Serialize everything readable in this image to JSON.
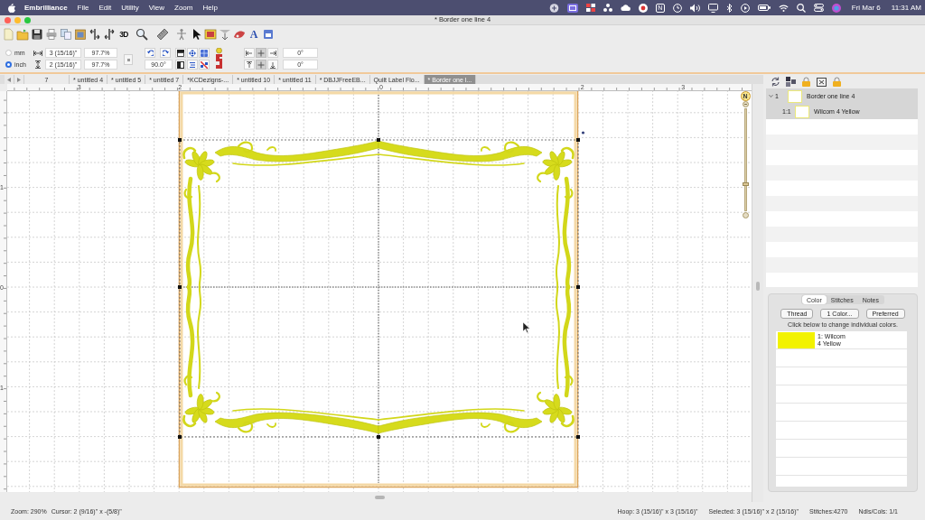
{
  "menu_bar": {
    "app_name": "Embrilliance",
    "menus": [
      "File",
      "Edit",
      "Utility",
      "View",
      "Zoom",
      "Help"
    ],
    "tray_letter": "N",
    "date": "Fri Mar 6",
    "time": "11:31 AM"
  },
  "window": {
    "title": "* Border one line 4"
  },
  "toolbar": {
    "text_tools": [
      "3D",
      "A"
    ]
  },
  "size": {
    "units": [
      {
        "label": "mm",
        "selected": false
      },
      {
        "label": "inch",
        "selected": true
      }
    ],
    "width": "3 (15/16)\"",
    "width_scale": "97.7%",
    "height": "2 (15/16)\"",
    "height_scale": "97.7%"
  },
  "arrange": {
    "rotation": "90.0°",
    "anchor_buttons": [
      {
        "selected": false
      },
      {
        "selected": true
      },
      {
        "selected": false
      },
      {
        "selected": false
      },
      {
        "selected": true
      },
      {
        "selected": false
      }
    ],
    "angles": [
      "0°",
      "0°"
    ]
  },
  "tabs": [
    {
      "label": "7",
      "selected": false
    },
    {
      "label": "* untitled 4",
      "selected": false
    },
    {
      "label": "* untitled 5",
      "selected": false
    },
    {
      "label": "* untitled 7",
      "selected": false
    },
    {
      "label": "*KCDezigns-...",
      "selected": false
    },
    {
      "label": "* untitled 10",
      "selected": false
    },
    {
      "label": "* untitled 11",
      "selected": false
    },
    {
      "label": "* DBJJFreeEB...",
      "selected": false
    },
    {
      "label": "Quilt Label Flo...",
      "selected": false
    },
    {
      "label": "* Border one l...",
      "selected": true
    }
  ],
  "rulers": {
    "top_labels": [
      "3",
      "2",
      "0",
      "2",
      "3"
    ],
    "left_labels": [
      "1",
      "0",
      "1"
    ]
  },
  "canvas": {
    "compass_label": "N",
    "zoom_slider": {
      "level": 0.26
    }
  },
  "layers": [
    {
      "number": "1",
      "name": "Border one line 4",
      "expanded": true,
      "selected": true,
      "children": [
        {
          "number": "1:1",
          "name": "Wilcom 4 Yellow",
          "selected": true
        }
      ]
    }
  ],
  "properties": {
    "tabs": [
      {
        "label": "Color",
        "selected": true
      },
      {
        "label": "Stitches",
        "selected": false
      },
      {
        "label": "Notes",
        "selected": false
      }
    ],
    "buttons": [
      "Thread",
      "1 Color...",
      "Preferred"
    ],
    "hint": "Click below to change individual colors.",
    "colors": [
      {
        "color": "#f2f200",
        "lines": [
          "1: Wilcom",
          "4 Yellow"
        ]
      }
    ]
  },
  "status_bar": {
    "zoom": "Zoom: 290%",
    "cursor": "Cursor: 2 (9/16)\" x -(5/8)\"",
    "hoop": "Hoop: 3 (15/16)\" x 3 (15/16)\"",
    "selection": "Selected: 3 (15/16)\" x 2 (15/16)\"",
    "stitches": "Stitches:4270",
    "needles": "Ndls/Cols: 1/1"
  }
}
